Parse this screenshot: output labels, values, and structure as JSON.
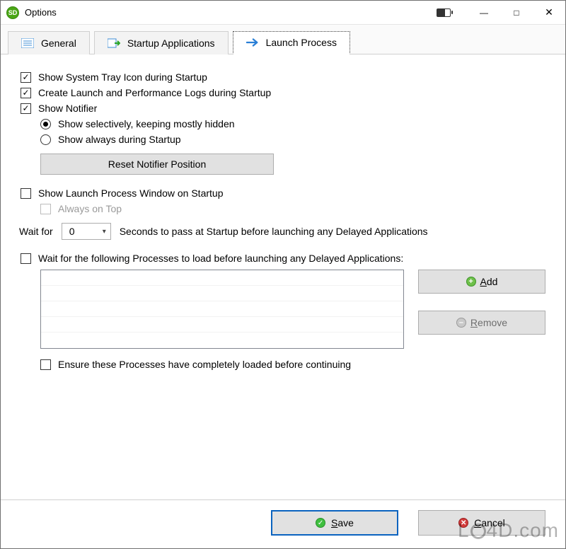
{
  "window": {
    "title": "Options",
    "app_badge": "SD"
  },
  "tabs": {
    "general": "General",
    "startup_apps": "Startup Applications",
    "launch_process": "Launch Process",
    "active_index": 2
  },
  "options": {
    "show_tray": {
      "label": "Show System Tray Icon during Startup",
      "checked": true
    },
    "create_logs": {
      "label": "Create Launch and Performance Logs during Startup",
      "checked": true
    },
    "show_notifier": {
      "label": "Show Notifier",
      "checked": true
    },
    "notifier_mode": {
      "selectively": "Show selectively, keeping mostly hidden",
      "always": "Show always during Startup",
      "selected": "selectively"
    },
    "reset_notifier_btn": "Reset Notifier Position",
    "show_lp_window": {
      "label": "Show Launch Process Window on Startup",
      "checked": false
    },
    "always_on_top": {
      "label": "Always on Top",
      "checked": false,
      "enabled": false
    },
    "wait_for": {
      "prefix": "Wait for",
      "value": "0",
      "suffix": "Seconds to pass at Startup before launching any Delayed Applications"
    },
    "wait_processes": {
      "label": "Wait for the following Processes to load before launching any Delayed Applications:",
      "checked": false
    },
    "add_btn": {
      "label": "Add",
      "mnemonic": "A"
    },
    "remove_btn": {
      "label": "Remove",
      "mnemonic": "R",
      "enabled": false
    },
    "ensure_loaded": {
      "label": "Ensure these Processes have completely loaded before continuing",
      "checked": false
    }
  },
  "footer": {
    "save": {
      "label": "Save",
      "mnemonic": "S"
    },
    "cancel": {
      "label": "Cancel",
      "mnemonic": "C"
    }
  },
  "watermark": "LO4D.com"
}
